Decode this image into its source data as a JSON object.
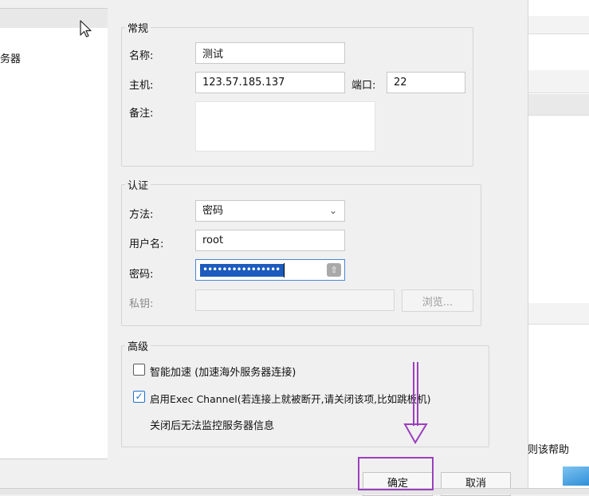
{
  "background": {
    "left_fragment": "务器",
    "right_help": "则该帮助"
  },
  "dialog": {
    "general": {
      "legend": "常规",
      "name_label": "名称:",
      "name_value": "测试",
      "host_label": "主机:",
      "host_value": "123.57.185.137",
      "port_label": "端口:",
      "port_value": "22",
      "note_label": "备注:"
    },
    "auth": {
      "legend": "认证",
      "method_label": "方法:",
      "method_value": "密码",
      "username_label": "用户名:",
      "username_value": "root",
      "password_label": "密码:",
      "password_mask": "••••••••••••••••",
      "privkey_label": "私钥:",
      "browse_label": "浏览..."
    },
    "advanced": {
      "legend": "高级",
      "smart_accel_label": "智能加速 (加速海外服务器连接)",
      "smart_accel_checked": false,
      "exec_channel_label": "启用Exec Channel(若连接上就被断开,请关闭该项,比如跳板机)",
      "exec_channel_checked": true,
      "exec_channel_note": "关闭后无法监控服务器信息"
    },
    "buttons": {
      "ok": "确定",
      "cancel": "取消"
    }
  },
  "colors": {
    "annotation": "#9b3fbf",
    "selection": "#1c5bbd",
    "checkbox_accent": "#1f6fd0"
  }
}
